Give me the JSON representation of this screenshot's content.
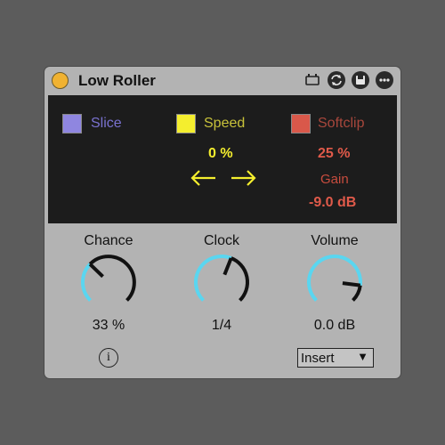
{
  "device": {
    "title": "Low Roller"
  },
  "display": {
    "slice": {
      "label": "Slice",
      "color": "#8f86e0",
      "text_color": "#7a72d0",
      "checked": false
    },
    "speed": {
      "label": "Speed",
      "color": "#f4ee2e",
      "text_color": "#c8c23a",
      "checked": false,
      "value": "0 %"
    },
    "softclip": {
      "label": "Softclip",
      "color": "#d9584a",
      "text_color": "#a8473c",
      "checked": false,
      "value": "25 %"
    },
    "gain": {
      "label": "Gain",
      "value": "-9.0 dB"
    },
    "arrow_color": "#f4ee2e"
  },
  "knobs": [
    {
      "label": "Chance",
      "value": "33 %",
      "fraction": 0.33
    },
    {
      "label": "Clock",
      "value": "1/4",
      "fraction": 0.58
    },
    {
      "label": "Volume",
      "value": "0.0 dB",
      "fraction": 0.86
    }
  ],
  "info_icon": "i",
  "routing": {
    "selected": "Insert",
    "arrow": "▼"
  },
  "colors": {
    "accent": "#5ad6f0",
    "power": "#f0b232"
  }
}
